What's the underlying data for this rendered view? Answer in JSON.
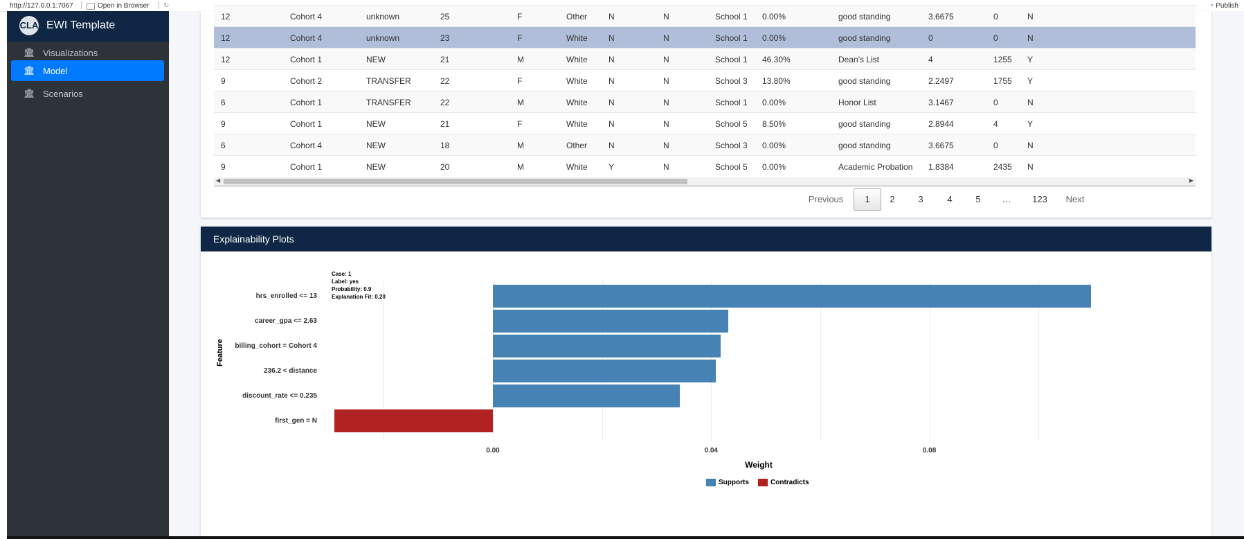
{
  "browser": {
    "url": "http://127.0.0.1:7067",
    "open_in_browser": "Open in Browser",
    "publish": "Publish"
  },
  "sidebar": {
    "brand_logo_text": "CLA",
    "brand_title": "EWI Template",
    "items": [
      {
        "label": "Visualizations",
        "icon": "bank-icon",
        "active": false
      },
      {
        "label": "Model",
        "icon": "bank-icon",
        "active": true
      },
      {
        "label": "Scenarios",
        "icon": "bank-icon",
        "active": false
      }
    ]
  },
  "table": {
    "rows": [
      [
        "12",
        "Cohort 4",
        "unknown",
        "25",
        "F",
        "Other",
        "N",
        "N",
        "School 1",
        "0.00%",
        "good standing",
        "3.6675",
        "0",
        "N"
      ],
      [
        "12",
        "Cohort 4",
        "unknown",
        "23",
        "F",
        "White",
        "N",
        "N",
        "School 1",
        "0.00%",
        "good standing",
        "0",
        "0",
        "N"
      ],
      [
        "12",
        "Cohort 1",
        "NEW",
        "21",
        "M",
        "White",
        "N",
        "N",
        "School 1",
        "46.30%",
        "Dean's List",
        "4",
        "1255",
        "Y"
      ],
      [
        "9",
        "Cohort 2",
        "TRANSFER",
        "22",
        "F",
        "White",
        "N",
        "N",
        "School 3",
        "13.80%",
        "good standing",
        "2.2497",
        "1755",
        "Y"
      ],
      [
        "6",
        "Cohort 1",
        "TRANSFER",
        "22",
        "M",
        "White",
        "N",
        "N",
        "School 1",
        "0.00%",
        "Honor List",
        "3.1467",
        "0",
        "N"
      ],
      [
        "9",
        "Cohort 1",
        "NEW",
        "21",
        "F",
        "White",
        "N",
        "N",
        "School 5",
        "8.50%",
        "good standing",
        "2.8944",
        "4",
        "Y"
      ],
      [
        "6",
        "Cohort 4",
        "NEW",
        "18",
        "M",
        "Other",
        "N",
        "N",
        "School 3",
        "0.00%",
        "good standing",
        "3.6675",
        "0",
        "N"
      ],
      [
        "9",
        "Cohort 1",
        "NEW",
        "20",
        "M",
        "White",
        "Y",
        "N",
        "School 5",
        "0.00%",
        "Academic Probation",
        "1.8384",
        "2435",
        "N"
      ]
    ],
    "selected_row": 1
  },
  "pager": {
    "previous": "Previous",
    "pages": [
      "1",
      "2",
      "3",
      "4",
      "5",
      "…",
      "123"
    ],
    "current": "1",
    "next": "Next"
  },
  "plot_card": {
    "title": "Explainability Plots"
  },
  "plot_meta": {
    "case": "Case: 1",
    "label": "Label: yes",
    "probability": "Probability: 0.9",
    "fit": "Explanation Fit: 0.28"
  },
  "colors": {
    "supports": "#4682b4",
    "contradicts": "#b22222",
    "brand": "#0f2644",
    "active": "#007bff"
  },
  "chart_data": {
    "type": "bar",
    "orientation": "horizontal",
    "categories": [
      "hrs_enrolled <= 13",
      "career_gpa <= 2.63",
      "billing_cohort = Cohort 4",
      "236.2 < distance",
      "discount_rate <= 0.235",
      "first_gen = N"
    ],
    "values": [
      0.1096,
      0.0431,
      0.0418,
      0.0408,
      0.0342,
      -0.0291
    ],
    "groups": [
      "Supports",
      "Supports",
      "Supports",
      "Supports",
      "Supports",
      "Contradicts"
    ],
    "xlabel": "Weight",
    "ylabel": "Feature",
    "xticks": [
      "0.00",
      "0.04",
      "0.08"
    ],
    "xtick_values": [
      0.0,
      0.04,
      0.08
    ],
    "xlim": [
      -0.0385,
      0.1285
    ],
    "grid": true,
    "legend": [
      "Supports",
      "Contradicts"
    ],
    "legend_position": "bottom"
  }
}
